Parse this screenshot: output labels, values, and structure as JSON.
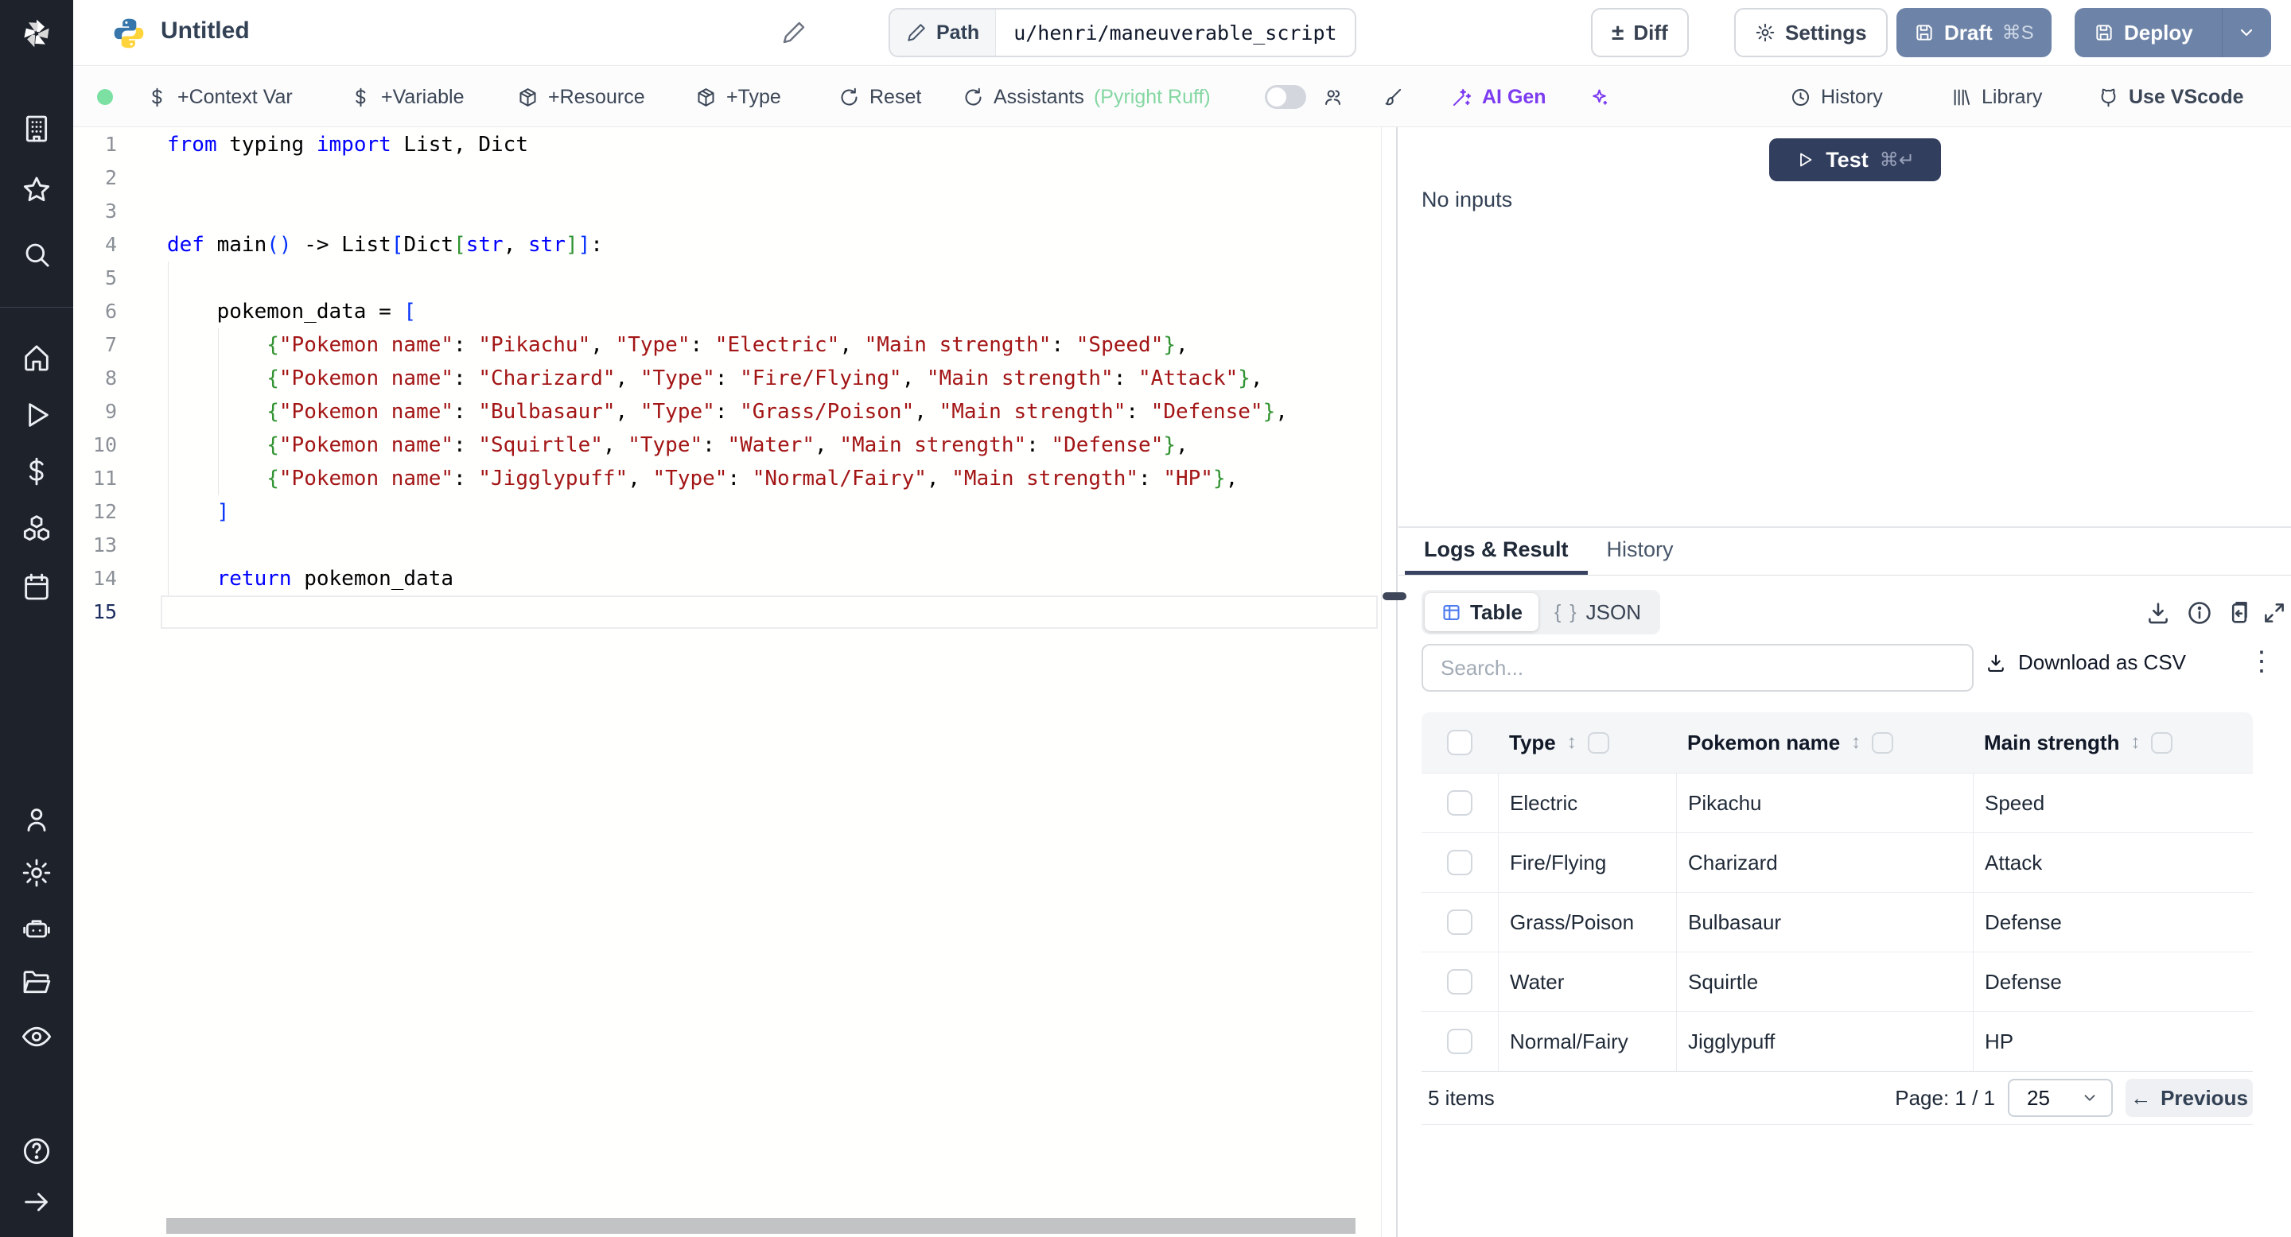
{
  "header": {
    "title": "Untitled",
    "path_label": "Path",
    "path_value": "u/henri/maneuverable_script",
    "diff_label": "Diff",
    "settings_label": "Settings",
    "draft_label": "Draft",
    "draft_shortcut": "⌘S",
    "deploy_label": "Deploy"
  },
  "toolbar": {
    "context_var": "+Context Var",
    "variable": "+Variable",
    "resource": "+Resource",
    "type": "+Type",
    "reset": "Reset",
    "assistants": "Assistants",
    "assistants_detail": "(Pyright Ruff)",
    "ai_gen": "AI Gen",
    "history": "History",
    "library": "Library",
    "vscode": "Use VScode"
  },
  "sidebar": {
    "icons": [
      "building",
      "star",
      "search",
      "home",
      "play",
      "dollar",
      "cubes",
      "calendar",
      "user",
      "gear",
      "robot",
      "folder",
      "eye",
      "help",
      "arrow-right"
    ]
  },
  "editor": {
    "language": "python",
    "lines": [
      {
        "n": 1,
        "active": false,
        "tokens": [
          [
            "k",
            "from"
          ],
          [
            "p",
            " typing "
          ],
          [
            "k",
            "import"
          ],
          [
            "p",
            " List, Dict"
          ]
        ]
      },
      {
        "n": 2,
        "active": false,
        "tokens": []
      },
      {
        "n": 3,
        "active": false,
        "tokens": []
      },
      {
        "n": 4,
        "active": false,
        "tokens": [
          [
            "k",
            "def"
          ],
          [
            "p",
            " main"
          ],
          [
            "b1",
            "()"
          ],
          [
            "p",
            " -> List"
          ],
          [
            "b1",
            "["
          ],
          [
            "p",
            "Dict"
          ],
          [
            "b2",
            "["
          ],
          [
            "k",
            "str"
          ],
          [
            "p",
            ", "
          ],
          [
            "k",
            "str"
          ],
          [
            "b2",
            "]"
          ],
          [
            "b1",
            "]"
          ],
          [
            "p",
            ":"
          ]
        ]
      },
      {
        "n": 5,
        "active": false,
        "tokens": []
      },
      {
        "n": 6,
        "active": false,
        "tokens": [
          [
            "p",
            "    pokemon_data = "
          ],
          [
            "b1",
            "["
          ]
        ]
      },
      {
        "n": 7,
        "active": false,
        "tokens": [
          [
            "p",
            "        "
          ],
          [
            "b2",
            "{"
          ],
          [
            "s",
            "\"Pokemon name\""
          ],
          [
            "p",
            ": "
          ],
          [
            "s",
            "\"Pikachu\""
          ],
          [
            "p",
            ", "
          ],
          [
            "s",
            "\"Type\""
          ],
          [
            "p",
            ": "
          ],
          [
            "s",
            "\"Electric\""
          ],
          [
            "p",
            ", "
          ],
          [
            "s",
            "\"Main strength\""
          ],
          [
            "p",
            ": "
          ],
          [
            "s",
            "\"Speed\""
          ],
          [
            "b2",
            "}"
          ],
          [
            "p",
            ","
          ]
        ]
      },
      {
        "n": 8,
        "active": false,
        "tokens": [
          [
            "p",
            "        "
          ],
          [
            "b2",
            "{"
          ],
          [
            "s",
            "\"Pokemon name\""
          ],
          [
            "p",
            ": "
          ],
          [
            "s",
            "\"Charizard\""
          ],
          [
            "p",
            ", "
          ],
          [
            "s",
            "\"Type\""
          ],
          [
            "p",
            ": "
          ],
          [
            "s",
            "\"Fire/Flying\""
          ],
          [
            "p",
            ", "
          ],
          [
            "s",
            "\"Main strength\""
          ],
          [
            "p",
            ": "
          ],
          [
            "s",
            "\"Attack\""
          ],
          [
            "b2",
            "}"
          ],
          [
            "p",
            ","
          ]
        ]
      },
      {
        "n": 9,
        "active": false,
        "tokens": [
          [
            "p",
            "        "
          ],
          [
            "b2",
            "{"
          ],
          [
            "s",
            "\"Pokemon name\""
          ],
          [
            "p",
            ": "
          ],
          [
            "s",
            "\"Bulbasaur\""
          ],
          [
            "p",
            ", "
          ],
          [
            "s",
            "\"Type\""
          ],
          [
            "p",
            ": "
          ],
          [
            "s",
            "\"Grass/Poison\""
          ],
          [
            "p",
            ", "
          ],
          [
            "s",
            "\"Main strength\""
          ],
          [
            "p",
            ": "
          ],
          [
            "s",
            "\"Defense\""
          ],
          [
            "b2",
            "}"
          ],
          [
            "p",
            ","
          ]
        ]
      },
      {
        "n": 10,
        "active": false,
        "tokens": [
          [
            "p",
            "        "
          ],
          [
            "b2",
            "{"
          ],
          [
            "s",
            "\"Pokemon name\""
          ],
          [
            "p",
            ": "
          ],
          [
            "s",
            "\"Squirtle\""
          ],
          [
            "p",
            ", "
          ],
          [
            "s",
            "\"Type\""
          ],
          [
            "p",
            ": "
          ],
          [
            "s",
            "\"Water\""
          ],
          [
            "p",
            ", "
          ],
          [
            "s",
            "\"Main strength\""
          ],
          [
            "p",
            ": "
          ],
          [
            "s",
            "\"Defense\""
          ],
          [
            "b2",
            "}"
          ],
          [
            "p",
            ","
          ]
        ]
      },
      {
        "n": 11,
        "active": false,
        "tokens": [
          [
            "p",
            "        "
          ],
          [
            "b2",
            "{"
          ],
          [
            "s",
            "\"Pokemon name\""
          ],
          [
            "p",
            ": "
          ],
          [
            "s",
            "\"Jigglypuff\""
          ],
          [
            "p",
            ", "
          ],
          [
            "s",
            "\"Type\""
          ],
          [
            "p",
            ": "
          ],
          [
            "s",
            "\"Normal/Fairy\""
          ],
          [
            "p",
            ", "
          ],
          [
            "s",
            "\"Main strength\""
          ],
          [
            "p",
            ": "
          ],
          [
            "s",
            "\"HP\""
          ],
          [
            "b2",
            "}"
          ],
          [
            "p",
            ","
          ]
        ]
      },
      {
        "n": 12,
        "active": false,
        "tokens": [
          [
            "p",
            "    "
          ],
          [
            "b1",
            "]"
          ]
        ]
      },
      {
        "n": 13,
        "active": false,
        "tokens": []
      },
      {
        "n": 14,
        "active": false,
        "tokens": [
          [
            "p",
            "    "
          ],
          [
            "k",
            "return"
          ],
          [
            "p",
            " pokemon_data"
          ]
        ]
      },
      {
        "n": 15,
        "active": true,
        "tokens": []
      }
    ]
  },
  "run": {
    "test_label": "Test",
    "test_shortcut": "⌘↵",
    "no_inputs": "No inputs"
  },
  "results": {
    "tabs": {
      "logs": "Logs & Result",
      "history": "History"
    },
    "active_tab": "Logs & Result",
    "view_toggle": {
      "table": "Table",
      "json": "JSON"
    },
    "search_placeholder": "Search...",
    "download_csv": "Download as CSV",
    "table": {
      "columns": [
        "Type",
        "Pokemon name",
        "Main strength"
      ],
      "rows": [
        [
          "Electric",
          "Pikachu",
          "Speed"
        ],
        [
          "Fire/Flying",
          "Charizard",
          "Attack"
        ],
        [
          "Grass/Poison",
          "Bulbasaur",
          "Defense"
        ],
        [
          "Water",
          "Squirtle",
          "Defense"
        ],
        [
          "Normal/Fairy",
          "Jigglypuff",
          "HP"
        ]
      ]
    },
    "footer": {
      "items": "5 items",
      "page": "Page: 1 / 1",
      "page_size": "25",
      "previous": "Previous"
    }
  },
  "glyphs": {
    "diff_plusminus": "±",
    "braces": "{ }",
    "sort": "↕",
    "kebab": "⋮",
    "arrow_left": "←"
  },
  "colors": {
    "accent_slate": "#6d83a7",
    "test_navy": "#323e5e",
    "status_green": "#7ce0a3",
    "assistant_green": "#85d7a2",
    "ai_purple": "#7c3bf0",
    "table_icon_blue": "#4d7cf0",
    "code_keyword": "#0000ff",
    "code_string": "#a31515",
    "bracket_blue": "#0431fa",
    "bracket_green": "#319331"
  }
}
